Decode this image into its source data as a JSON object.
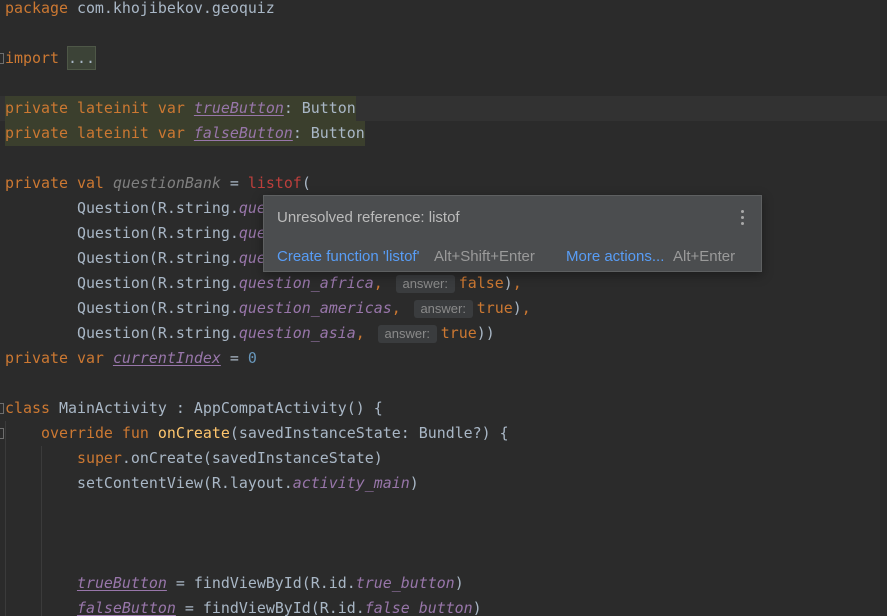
{
  "colors": {
    "background": "#2B2B2B",
    "text": "#A9B7C6",
    "keyword": "#CC7832",
    "property": "#9876AA",
    "unused": "#808080",
    "function": "#FFC66D",
    "number": "#6897BB",
    "unresolved": "#BC3F3C",
    "current_line": "#323232",
    "highlight": "#3B3F2D",
    "hint_background": "#3A3C3E",
    "hint_text": "#8A8A8A",
    "fold_background": "#3C4337",
    "popup_background": "#4B4D4F",
    "popup_border": "#5E6061",
    "popup_text": "#BBBBBB",
    "link": "#589DF6",
    "shortcut": "#9A9A9A"
  },
  "editor": {
    "lines": [
      {
        "tokens": [
          {
            "type": "keyword",
            "text": "package"
          },
          {
            "type": "plain",
            "text": " com.khojibekov.geoquiz"
          }
        ]
      },
      {
        "tokens": []
      },
      {
        "fold_marker": true,
        "tokens": [
          {
            "type": "keyword",
            "text": "import"
          },
          {
            "type": "plain",
            "text": " "
          },
          {
            "type": "folded",
            "text": "..."
          }
        ]
      },
      {
        "tokens": []
      },
      {
        "current": true,
        "highlighted": true,
        "tokens": [
          {
            "type": "keyword",
            "text": "private lateinit var"
          },
          {
            "type": "plain",
            "text": " "
          },
          {
            "type": "mutable-property",
            "text": "trueButton"
          },
          {
            "type": "plain",
            "text": ": Button"
          }
        ]
      },
      {
        "highlighted": true,
        "tokens": [
          {
            "type": "keyword",
            "text": "private lateinit var"
          },
          {
            "type": "plain",
            "text": " "
          },
          {
            "type": "mutable-property",
            "text": "falseButton"
          },
          {
            "type": "plain",
            "text": ": Button"
          }
        ]
      },
      {
        "tokens": []
      },
      {
        "tokens": [
          {
            "type": "keyword",
            "text": "private val"
          },
          {
            "type": "plain",
            "text": " "
          },
          {
            "type": "unused-property",
            "text": "questionBank"
          },
          {
            "type": "plain",
            "text": " = "
          },
          {
            "type": "unresolved",
            "text": "listof"
          },
          {
            "type": "plain",
            "text": "("
          }
        ]
      },
      {
        "tokens": [
          {
            "type": "plain",
            "text": "        Question(R.string."
          },
          {
            "type": "field",
            "text": "que"
          }
        ]
      },
      {
        "tokens": [
          {
            "type": "plain",
            "text": "        Question(R.string."
          },
          {
            "type": "field",
            "text": "que"
          }
        ]
      },
      {
        "tokens": [
          {
            "type": "plain",
            "text": "        Question(R.string."
          },
          {
            "type": "field",
            "text": "que"
          }
        ]
      },
      {
        "tokens": [
          {
            "type": "plain",
            "text": "        Question(R.string."
          },
          {
            "type": "field",
            "text": "question_africa"
          },
          {
            "type": "keyword",
            "text": ","
          },
          {
            "type": "plain",
            "text": " "
          },
          {
            "type": "parameter-hint",
            "text": "answer:"
          },
          {
            "type": "keyword",
            "text": "false"
          },
          {
            "type": "plain",
            "text": ")"
          },
          {
            "type": "keyword",
            "text": ","
          }
        ]
      },
      {
        "tokens": [
          {
            "type": "plain",
            "text": "        Question(R.string."
          },
          {
            "type": "field",
            "text": "question_americas"
          },
          {
            "type": "keyword",
            "text": ","
          },
          {
            "type": "plain",
            "text": " "
          },
          {
            "type": "parameter-hint",
            "text": "answer:"
          },
          {
            "type": "keyword",
            "text": "true"
          },
          {
            "type": "plain",
            "text": ")"
          },
          {
            "type": "keyword",
            "text": ","
          }
        ]
      },
      {
        "tokens": [
          {
            "type": "plain",
            "text": "        Question(R.string."
          },
          {
            "type": "field",
            "text": "question_asia"
          },
          {
            "type": "keyword",
            "text": ","
          },
          {
            "type": "plain",
            "text": " "
          },
          {
            "type": "parameter-hint",
            "text": "answer:"
          },
          {
            "type": "keyword",
            "text": "true"
          },
          {
            "type": "plain",
            "text": "))"
          }
        ]
      },
      {
        "tokens": [
          {
            "type": "keyword",
            "text": "private var"
          },
          {
            "type": "plain",
            "text": " "
          },
          {
            "type": "mutable-property",
            "text": "currentIndex"
          },
          {
            "type": "plain",
            "text": " = "
          },
          {
            "type": "number",
            "text": "0"
          }
        ]
      },
      {
        "tokens": []
      },
      {
        "fold_marker": true,
        "tokens": [
          {
            "type": "keyword",
            "text": "class"
          },
          {
            "type": "plain",
            "text": " MainActivity : AppCompatActivity() {"
          }
        ]
      },
      {
        "fold_marker": true,
        "tokens": [
          {
            "type": "plain",
            "text": "    "
          },
          {
            "type": "keyword",
            "text": "override fun"
          },
          {
            "type": "plain",
            "text": " "
          },
          {
            "type": "function-declaration",
            "text": "onCreate"
          },
          {
            "type": "plain",
            "text": "(savedInstanceState: Bundle?) {"
          }
        ]
      },
      {
        "tokens": [
          {
            "type": "plain",
            "text": "        "
          },
          {
            "type": "keyword",
            "text": "super"
          },
          {
            "type": "plain",
            "text": ".onCreate(savedInstanceState)"
          }
        ]
      },
      {
        "tokens": [
          {
            "type": "plain",
            "text": "        setContentView(R.layout."
          },
          {
            "type": "field",
            "text": "activity_main"
          },
          {
            "type": "plain",
            "text": ")"
          }
        ]
      },
      {
        "tokens": []
      },
      {
        "tokens": []
      },
      {
        "tokens": []
      },
      {
        "tokens": [
          {
            "type": "plain",
            "text": "        "
          },
          {
            "type": "mutable-property",
            "text": "trueButton"
          },
          {
            "type": "plain",
            "text": " = findViewById(R.id."
          },
          {
            "type": "field",
            "text": "true_button"
          },
          {
            "type": "plain",
            "text": ")"
          }
        ]
      },
      {
        "tokens": [
          {
            "type": "plain",
            "text": "        "
          },
          {
            "type": "mutable-property",
            "text": "falseButton"
          },
          {
            "type": "plain",
            "text": " = findViewById(R.id."
          },
          {
            "type": "field",
            "text": "false_button"
          },
          {
            "type": "plain",
            "text": ")"
          }
        ]
      }
    ]
  },
  "popup": {
    "message": "Unresolved reference: listof",
    "menu_icon": "more-vertical-icon",
    "actions": [
      {
        "label": "Create function 'listof'",
        "shortcut": "Alt+Shift+Enter"
      },
      {
        "label": "More actions...",
        "shortcut": "Alt+Enter"
      }
    ]
  }
}
